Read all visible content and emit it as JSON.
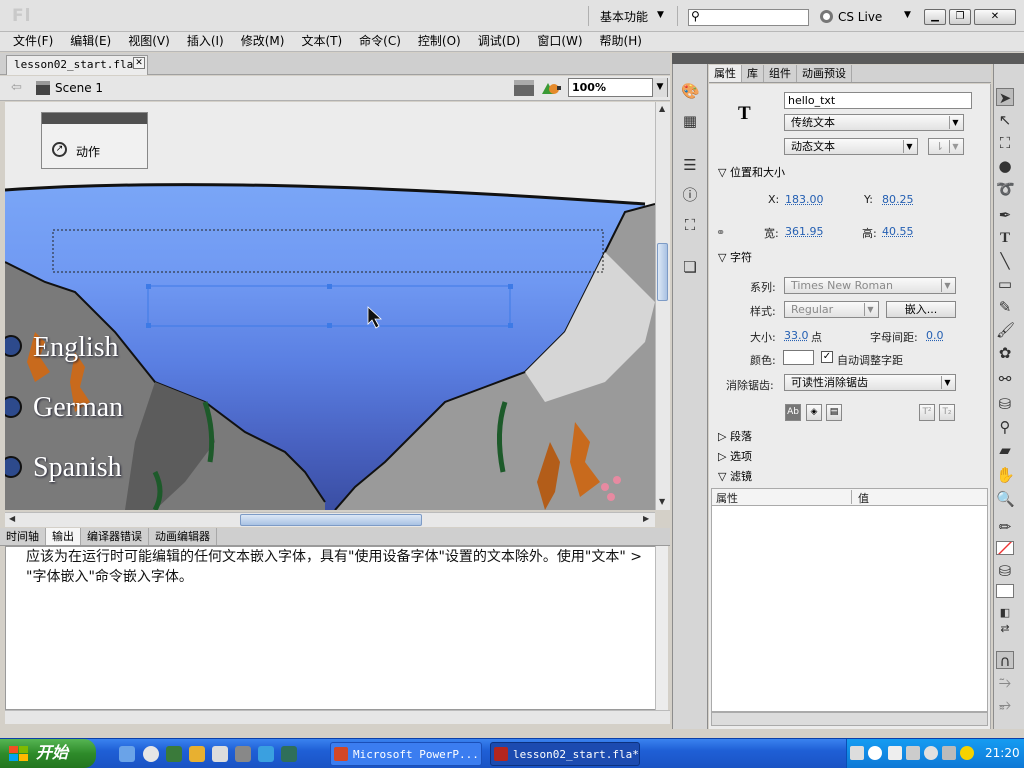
{
  "app": {
    "logo": "Fl",
    "workspace": "基本功能",
    "search_placeholder": "",
    "cs_live": "CS Live"
  },
  "menu": [
    "文件(F)",
    "编辑(E)",
    "视图(V)",
    "插入(I)",
    "修改(M)",
    "文本(T)",
    "命令(C)",
    "控制(O)",
    "调试(D)",
    "窗口(W)",
    "帮助(H)"
  ],
  "document": {
    "tab_title": "lesson02_start.fla*",
    "scene": "Scene 1",
    "zoom": "100%"
  },
  "stage": {
    "actions_panel_label": "动作",
    "languages": [
      "English",
      "German",
      "Spanish"
    ]
  },
  "bottom_panel": {
    "tabs": [
      "时间轴",
      "输出",
      "编译器错误",
      "动画编辑器"
    ],
    "active_tab": "输出",
    "output_text": "应该为在运行时可能编辑的任何文本嵌入字体，具有\"使用设备字体\"设置的文本除外。使用\"文本\" > \"字体嵌入\"命令嵌入字体。"
  },
  "properties": {
    "tabs": [
      "属性",
      "库",
      "组件",
      "动画预设"
    ],
    "active_tab": "属性",
    "instance_name": "hello_txt",
    "text_engine": "传统文本",
    "text_type": "动态文本",
    "position_section": "位置和大小",
    "x_label": "X:",
    "x_value": "183.00",
    "y_label": "Y:",
    "y_value": "80.25",
    "w_label": "宽:",
    "w_value": "361.95",
    "h_label": "高:",
    "h_value": "40.55",
    "char_section": "字符",
    "family_label": "系列:",
    "family_value": "Times New Roman",
    "style_label": "样式:",
    "style_value": "Regular",
    "embed_button": "嵌入...",
    "size_label": "大小:",
    "size_value": "33.0",
    "size_unit": "点",
    "spacing_label": "字母间距:",
    "spacing_value": "0.0",
    "color_label": "颜色:",
    "autokern_label": "自动调整字距",
    "antialias_label": "消除锯齿:",
    "antialias_value": "可读性消除锯齿",
    "paragraph_section": "段落",
    "options_section": "选项",
    "filters_section": "滤镜",
    "filter_col_property": "属性",
    "filter_col_value": "值"
  },
  "taskbar": {
    "start": "开始",
    "items": [
      "Microsoft PowerP...",
      "lesson02_start.fla*"
    ],
    "clock": "21:20"
  },
  "colors": {
    "stage_blue_top": "#6f9af5",
    "stage_blue_mid": "#5a7fe2",
    "selection": "#3d7ae6",
    "taskbar": "#245edb",
    "start": "#3a9a35"
  }
}
